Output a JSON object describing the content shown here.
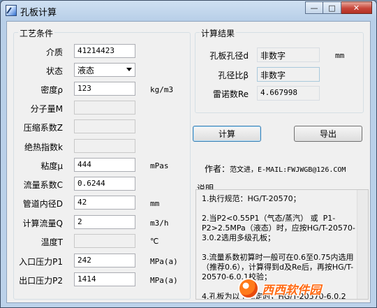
{
  "window": {
    "title": "孔板计算",
    "minimize_glyph": "—",
    "maximize_glyph": "□",
    "close_glyph": "✕"
  },
  "conditions": {
    "group_title": "工艺条件",
    "fields": [
      {
        "label": "介质",
        "value": "41214423",
        "unit": "",
        "enabled": true
      },
      {
        "label": "状态",
        "value": "液态",
        "unit": "",
        "enabled": true,
        "type": "combo"
      },
      {
        "label": "密度ρ",
        "value": "123",
        "unit": "kg/m3",
        "enabled": true
      },
      {
        "label": "分子量M",
        "value": "",
        "unit": "",
        "enabled": false
      },
      {
        "label": "压缩系数Z",
        "value": "",
        "unit": "",
        "enabled": false
      },
      {
        "label": "绝热指数k",
        "value": "",
        "unit": "",
        "enabled": false
      },
      {
        "label": "粘度μ",
        "value": "444",
        "unit": "mPas",
        "enabled": true
      },
      {
        "label": "流量系数C",
        "value": "0.6244",
        "unit": "",
        "enabled": true
      },
      {
        "label": "管道内径D",
        "value": "42",
        "unit": "mm",
        "enabled": true
      },
      {
        "label": "计算流量Q",
        "value": "2",
        "unit": "m3/h",
        "enabled": true
      },
      {
        "label": "温度T",
        "value": "",
        "unit": "℃",
        "enabled": false
      },
      {
        "label": "入口压力P1",
        "value": "242",
        "unit": "MPa(a)",
        "enabled": true
      },
      {
        "label": "出口压力P2",
        "value": "1414",
        "unit": "MPa(a)",
        "enabled": true
      }
    ]
  },
  "results": {
    "group_title": "计算结果",
    "orifice_label": "孔板孔径d",
    "orifice_value": "非数字",
    "orifice_unit": "mm",
    "beta_label": "孔径比β",
    "beta_value": "非数字",
    "reynolds_label": "雷诺数Re",
    "reynolds_value": "4.667998"
  },
  "buttons": {
    "calculate": "计算",
    "export": "导出"
  },
  "author": {
    "label": "作者：",
    "value": "范文进，E-MAIL:FWJWGB@126.COM"
  },
  "notes": {
    "title": "说明",
    "text": "1.执行规范：HG/T-20570；\n\n2.当P2<0.55P1（气态/蒸汽） 或  P1-P2>2.5MPa（液态）时，应按HG/T-20570-3.0.2选用多级孔板；\n\n3.流量系数初算时一般可在0.6至0.75内选用（推荐0.6），计算得到d及Re后，再按HG/T-20570-6.0.1校验；\n\n4.孔板为以下规定时，HG/T-20570-6.0.2"
  },
  "watermark": {
    "text": "西西软件园"
  }
}
